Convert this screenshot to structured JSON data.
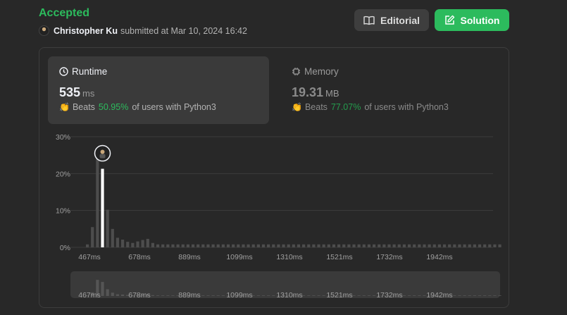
{
  "header": {
    "status": "Accepted",
    "user": "Christopher Ku",
    "submitted_text": "submitted at Mar 10, 2024 16:42",
    "editorial_label": "Editorial",
    "solution_label": "Solution"
  },
  "runtime": {
    "title": "Runtime",
    "value": "535",
    "unit": "ms",
    "beats_label": "Beats",
    "beats_pct": "50.95%",
    "beats_suffix": "of users with Python3"
  },
  "memory": {
    "title": "Memory",
    "value": "19.31",
    "unit": "MB",
    "beats_label": "Beats",
    "beats_pct": "77.07%",
    "beats_suffix": "of users with Python3"
  },
  "colors": {
    "accent": "#2cbb5d",
    "bar": "#4d4d4d",
    "selected": "#ffffff"
  },
  "chart_data": {
    "type": "bar",
    "title": "",
    "xlabel": "",
    "ylabel": "",
    "ylim": [
      0,
      30
    ],
    "y_ticks": [
      "0%",
      "10%",
      "20%",
      "30%"
    ],
    "x_ticks": [
      "467ms",
      "678ms",
      "889ms",
      "1099ms",
      "1310ms",
      "1521ms",
      "1732ms",
      "1942ms"
    ],
    "values": [
      0.8,
      5.5,
      24.5,
      21.3,
      10.2,
      5,
      2.6,
      2.1,
      1.5,
      1.2,
      1.6,
      2,
      2.3,
      1.2,
      0.8,
      0.8,
      0.8,
      0.8,
      0.8,
      0.8,
      0.8,
      0.8,
      0.8,
      0.8,
      0.8,
      0.8,
      0.8,
      0.8,
      0.8,
      0.8,
      0.8,
      0.8,
      0.8,
      0.8,
      0.8,
      0.8,
      0.8,
      0.8,
      0.8,
      0.8,
      0.8,
      0.8,
      0.8,
      0.8,
      0.8,
      0.8,
      0.8,
      0.8,
      0.8,
      0.8,
      0.8,
      0.8,
      0.8,
      0.8,
      0.8,
      0.8,
      0.8,
      0.8,
      0.8,
      0.8,
      0.8,
      0.8,
      0.8,
      0.8,
      0.8,
      0.8,
      0.8,
      0.8,
      0.8,
      0.8,
      0.8,
      0.8,
      0.8,
      0.8,
      0.8,
      0.8,
      0.8,
      0.8,
      0.8,
      0.8,
      0.8,
      0.8,
      0.8
    ],
    "selected_index": 3,
    "grid": true
  }
}
